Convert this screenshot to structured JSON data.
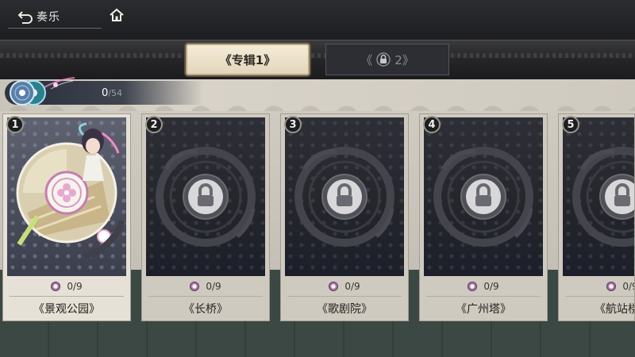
{
  "header": {
    "back_label": "奏乐",
    "back_icon": "back-arrow-icon",
    "home_icon": "home-icon"
  },
  "album_tabs": [
    {
      "label": "《专辑1》",
      "active": true
    },
    {
      "label_left": "《",
      "label_right": "2》",
      "locked": true,
      "icon": "lock-icon"
    }
  ],
  "progress": {
    "current": "0",
    "total": "/54",
    "icon": "music-disc-icon"
  },
  "songs": [
    {
      "number": "1",
      "count": "0/9",
      "title": "《景观公园》",
      "unlocked": true
    },
    {
      "number": "2",
      "count": "0/9",
      "title": "《长桥》",
      "unlocked": false
    },
    {
      "number": "3",
      "count": "0/9",
      "title": "《歌剧院》",
      "unlocked": false
    },
    {
      "number": "4",
      "count": "0/9",
      "title": "《广州塔》",
      "unlocked": false
    },
    {
      "number": "5",
      "count": "0/9",
      "title": "《航站楼》",
      "unlocked": false
    }
  ],
  "colors": {
    "active_tab_bg": "#ebe1c9",
    "card_bg": "#e6e1d6",
    "dark_art": "#24252b",
    "accent_pink": "#d685b8"
  }
}
